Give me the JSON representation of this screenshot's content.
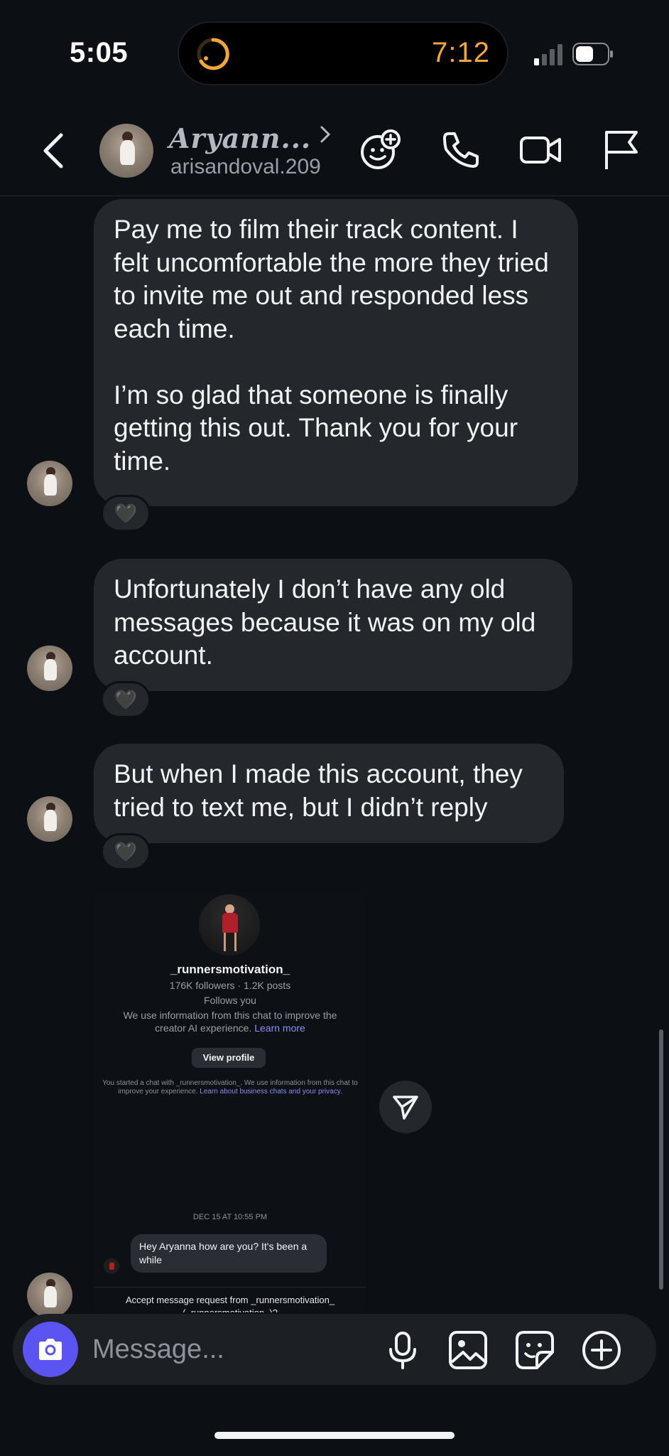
{
  "status_bar": {
    "time": "5:05",
    "live_activity_time": "7:12"
  },
  "header": {
    "contact_name": "Aryann...",
    "username": "arisandoval.209",
    "icons": [
      "back-icon",
      "add-sticker-icon",
      "phone-icon",
      "video-icon",
      "flag-icon"
    ]
  },
  "messages": [
    {
      "text": "Pay me to film their track content. I felt uncomfortable the more they tried to invite me out and responded less each time.\n\nI’m so glad that someone is finally getting this out. Thank you for your time.",
      "reaction": "🖤"
    },
    {
      "text": "Unfortunately I don’t have any old messages because it was on my old account.",
      "reaction": "🖤"
    },
    {
      "text": "But when I made this account, they tried to text me, but I didn’t reply",
      "reaction": "🖤"
    }
  ],
  "shared_screenshot": {
    "username": "_runnersmotivation_",
    "stats": "176K followers · 1.2K posts",
    "follows": "Follows you",
    "info": "We use information from this chat to improve the creator AI experience.",
    "info_link": "Learn more",
    "view_profile": "View profile",
    "note": "You started a chat with _runnersmotivation_. We use information from this chat to improve your experience.",
    "note_link": "Learn about business chats and your privacy.",
    "date": "DEC 15 AT 10:55 PM",
    "message": "Hey Aryanna how are you? It's been a while",
    "accept_line1": "Accept message request from _runnersmotivation_",
    "accept_line2": "(_runnersmotivation_)?"
  },
  "composer": {
    "placeholder": "Message...",
    "icons": [
      "camera-icon",
      "microphone-icon",
      "gallery-icon",
      "sticker-icon",
      "plus-icon"
    ]
  },
  "colors": {
    "background": "#0c0f14",
    "bubble": "#24272c",
    "accent": "#5b53f2",
    "live_activity": "#f3a63a"
  }
}
